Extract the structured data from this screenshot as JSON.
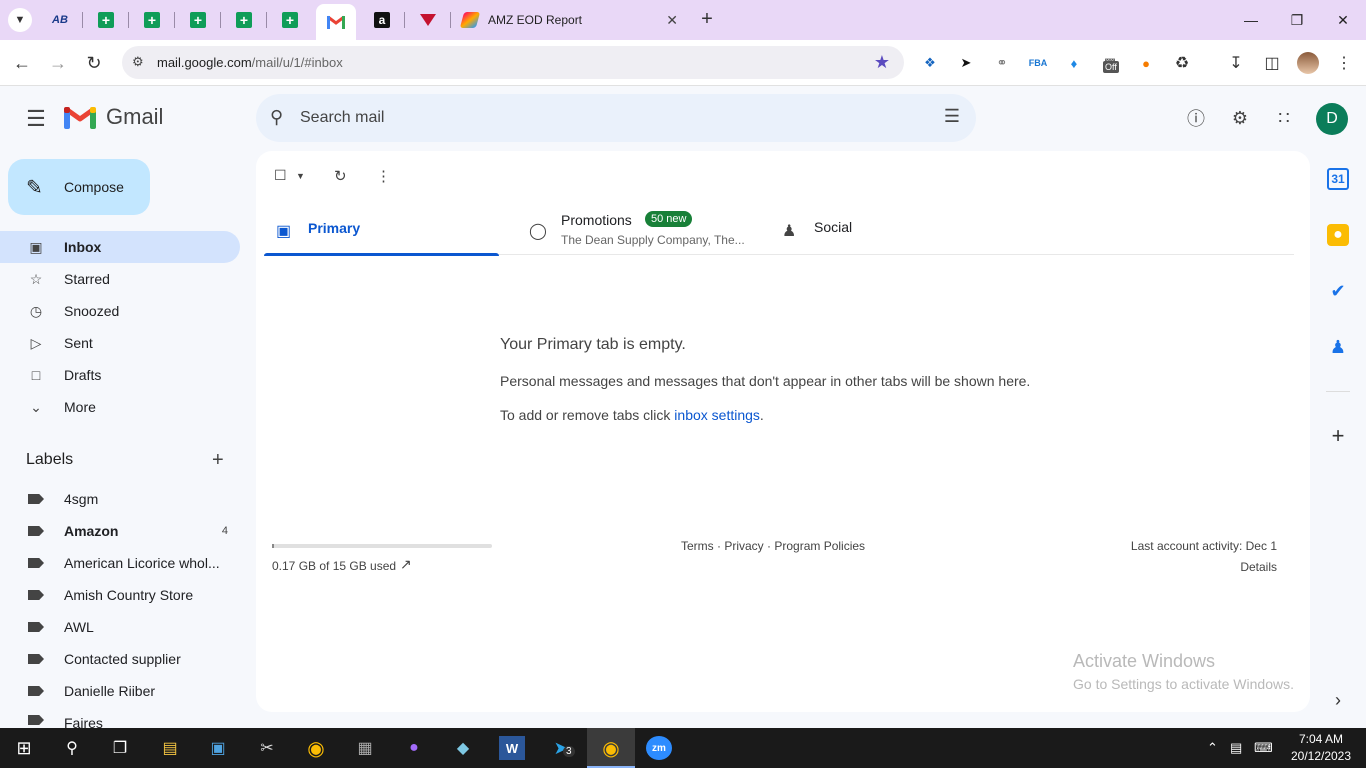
{
  "browser": {
    "active_tab_title": "AMZ EOD Report",
    "url_host": "mail.google.com",
    "url_path": "/mail/u/1/#inbox",
    "extension_badge": "Off"
  },
  "gmail": {
    "brand": "Gmail",
    "search_placeholder": "Search mail",
    "user_initial": "D",
    "compose_label": "Compose",
    "nav": [
      {
        "label": "Inbox",
        "icon": "inbox-icon"
      },
      {
        "label": "Starred",
        "icon": "star-icon"
      },
      {
        "label": "Snoozed",
        "icon": "clock-icon"
      },
      {
        "label": "Sent",
        "icon": "send-icon"
      },
      {
        "label": "Drafts",
        "icon": "draft-icon"
      },
      {
        "label": "More",
        "icon": "chevron-down-icon"
      }
    ],
    "labels_heading": "Labels",
    "labels": [
      {
        "name": "4sgm",
        "count": ""
      },
      {
        "name": "Amazon",
        "count": "4"
      },
      {
        "name": "American Licorice whol...",
        "count": ""
      },
      {
        "name": "Amish Country Store",
        "count": ""
      },
      {
        "name": "AWL",
        "count": ""
      },
      {
        "name": "Contacted supplier",
        "count": ""
      },
      {
        "name": "Danielle Riiber",
        "count": ""
      },
      {
        "name": "Faires",
        "count": ""
      }
    ],
    "tabs": {
      "primary": "Primary",
      "promotions": "Promotions",
      "promotions_badge": "50 new",
      "promotions_sub": "The Dean Supply Company, The...",
      "social": "Social"
    },
    "empty": {
      "title": "Your Primary tab is empty.",
      "line1": "Personal messages and messages that don't appear in other tabs will be shown here.",
      "line2_prefix": "To add or remove tabs click ",
      "line2_link": "inbox settings",
      "line2_suffix": "."
    },
    "footer": {
      "storage": "0.17 GB of 15 GB used",
      "storage_fraction": 0.011,
      "terms": "Terms",
      "privacy": "Privacy",
      "policies": "Program Policies",
      "sep": " · ",
      "activity": "Last account activity: Dec 1",
      "details": "Details"
    },
    "watermark": {
      "line1": "Activate Windows",
      "line2": "Go to Settings to activate Windows."
    }
  },
  "taskbar": {
    "time": "7:04 AM",
    "date": "20/12/2023",
    "telegram_badge": "3"
  }
}
